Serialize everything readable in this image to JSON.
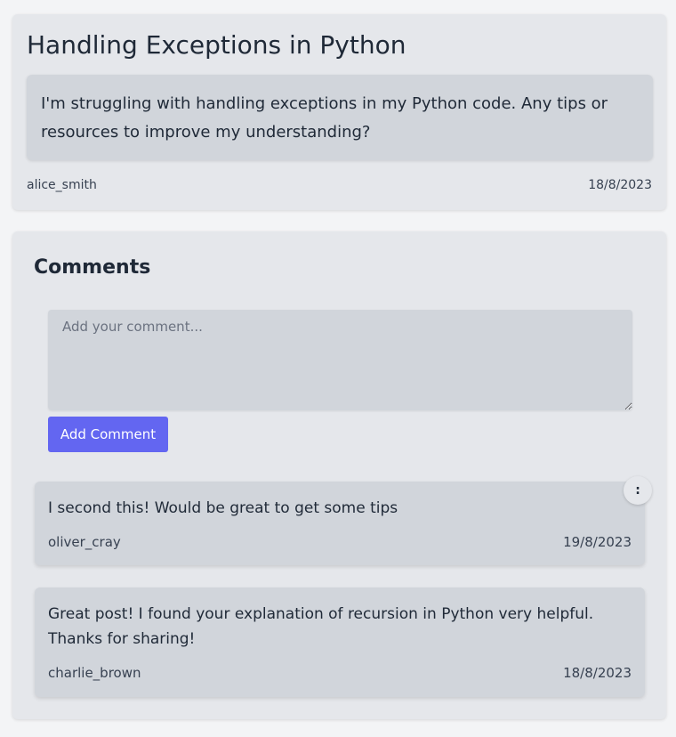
{
  "post": {
    "title": "Handling Exceptions in Python",
    "body": "I'm struggling with handling exceptions in my Python code. Any tips or resources to improve my understanding?",
    "author": "alice_smith",
    "date": "18/8/2023"
  },
  "comments_section": {
    "heading": "Comments",
    "input_placeholder": "Add your comment...",
    "input_value": "",
    "add_button_label": "Add Comment",
    "menu_button_glyph": ":",
    "items": [
      {
        "text": "I second this! Would be great to get some tips",
        "author": "oliver_cray",
        "date": "19/8/2023"
      },
      {
        "text": "Great post! I found your explanation of recursion in Python very helpful. Thanks for sharing!",
        "author": "charlie_brown",
        "date": "18/8/2023"
      }
    ]
  },
  "colors": {
    "page_background": "#f3f4f6",
    "card_background": "#e5e7eb",
    "inner_background": "#d1d5db",
    "accent": "#6366f1"
  },
  "icons": {
    "comment_menu": "more-options-icon"
  }
}
